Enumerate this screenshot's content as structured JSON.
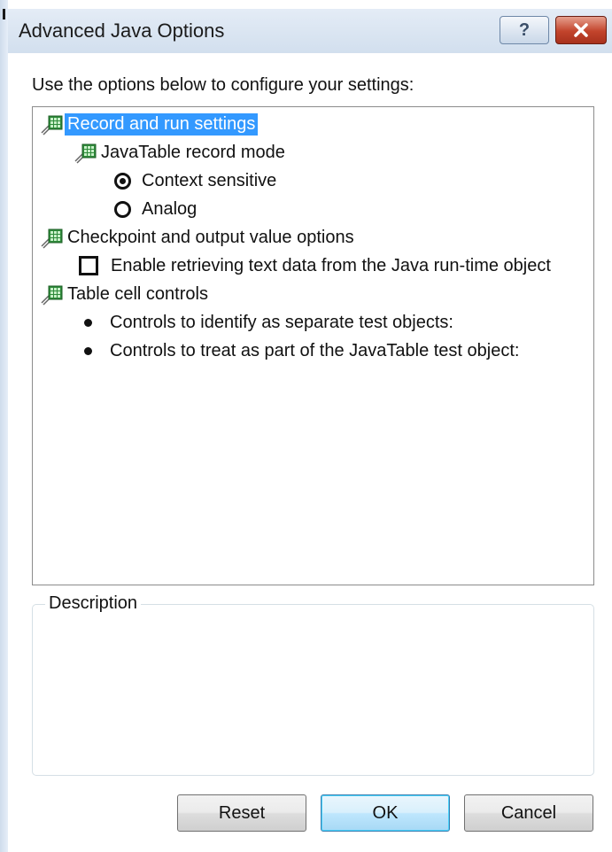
{
  "window": {
    "title": "Advanced Java Options",
    "help_glyph": "?",
    "close_icon": "close-icon"
  },
  "intro_text": "Use the options below to configure your settings:",
  "tree": {
    "record_run": {
      "label": "Record and run settings",
      "selected": true
    },
    "javatable_mode": {
      "label": "JavaTable record mode"
    },
    "radio_context": {
      "label": "Context sensitive",
      "checked": true
    },
    "radio_analog": {
      "label": "Analog",
      "checked": false
    },
    "checkpoint": {
      "label": "Checkpoint and output value options"
    },
    "enable_retrieve": {
      "label": "Enable retrieving text data from the Java run-time object",
      "checked": false
    },
    "table_cell": {
      "label": "Table cell controls"
    },
    "separate_objects": {
      "label": "Controls to identify as separate test objects:"
    },
    "part_of_object": {
      "label": "Controls to treat as part of the JavaTable test object:"
    }
  },
  "description": {
    "label": "Description",
    "text": ""
  },
  "buttons": {
    "reset": "Reset",
    "ok": "OK",
    "cancel": "Cancel"
  },
  "colors": {
    "selection": "#3399ff",
    "titlebar": "#d2dfee",
    "close_button": "#c2432b"
  }
}
